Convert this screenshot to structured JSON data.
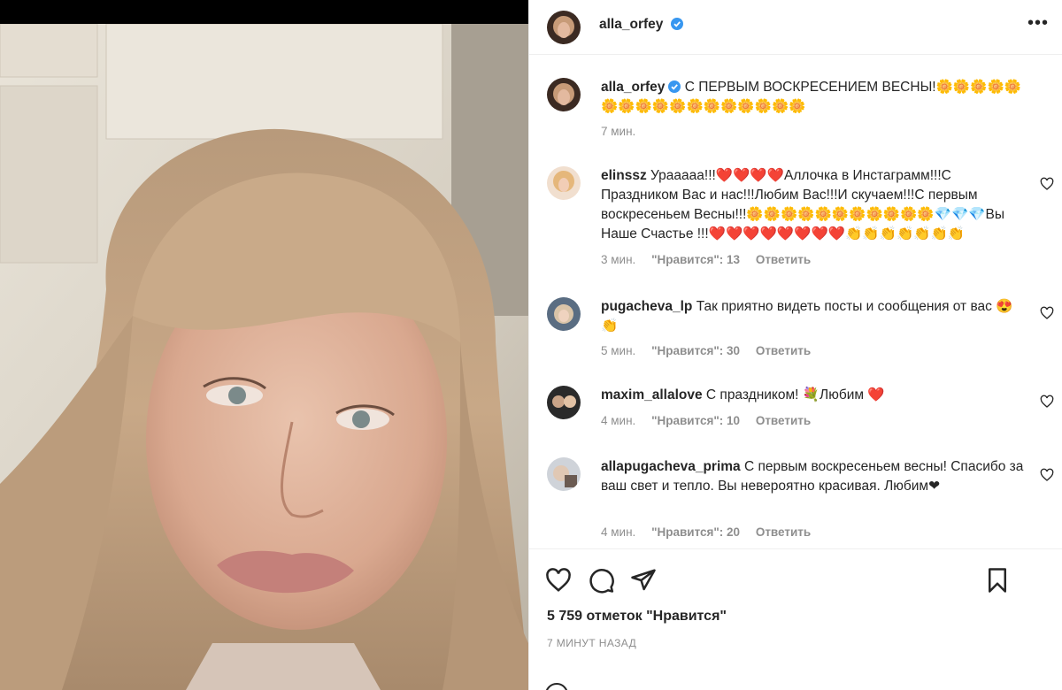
{
  "post": {
    "author": "alla_orfey",
    "caption": "С ПЕРВЫМ ВОСКРЕСЕНИЕМ ВЕСНЫ!🌼🌼🌼🌼🌼🌼🌼🌼🌼🌼🌼🌼🌼🌼🌼🌼🌼",
    "caption_time": "7 мин.",
    "likes": "5 759 отметок \"Нравится\"",
    "posted": "7 МИНУТ НАЗАД"
  },
  "comments": [
    {
      "user": "elinssz",
      "text": "Урааааа!!!❤️❤️❤️❤️Аллочка в Инстаграмм!!!С Праздником Вас и нас!!!Любим Вас!!!И скучаем!!!С первым воскресеньем Весны!!!🌼🌼🌼🌼🌼🌼🌼🌼🌼🌼🌼💎💎💎Вы Наше Счастье !!!❤️❤️❤️❤️❤️❤️❤️❤️👏👏👏👏👏👏👏",
      "time": "3 мин.",
      "likes": "\"Нравится\": 13",
      "reply": "Ответить"
    },
    {
      "user": "pugacheva_lp",
      "text": "Так приятно видеть посты и сообщения от вас 😍👏",
      "time": "5 мин.",
      "likes": "\"Нравится\": 30",
      "reply": "Ответить"
    },
    {
      "user": "maxim_allalove",
      "text": "С праздником! 💐Любим ❤️",
      "time": "4 мин.",
      "likes": "\"Нравится\": 10",
      "reply": "Ответить"
    },
    {
      "user": "allapugacheva_prima",
      "text": "С первым воскресеньем весны! Спасибо за ваш свет и тепло. Вы невероятно красивая. Любим❤",
      "time": "4 мин.",
      "likes": "\"Нравится\": 20",
      "reply": "Ответить"
    }
  ],
  "icons": {
    "more": "more-horizontal-icon",
    "like": "heart-icon",
    "comment": "comment-bubble-icon",
    "share": "send-paper-plane-icon",
    "save": "bookmark-icon",
    "verified": "verified-badge-icon"
  },
  "colors": {
    "text": "#262626",
    "secondary": "#8e8e8e",
    "verified": "#3897f0",
    "divider": "#efefef"
  }
}
